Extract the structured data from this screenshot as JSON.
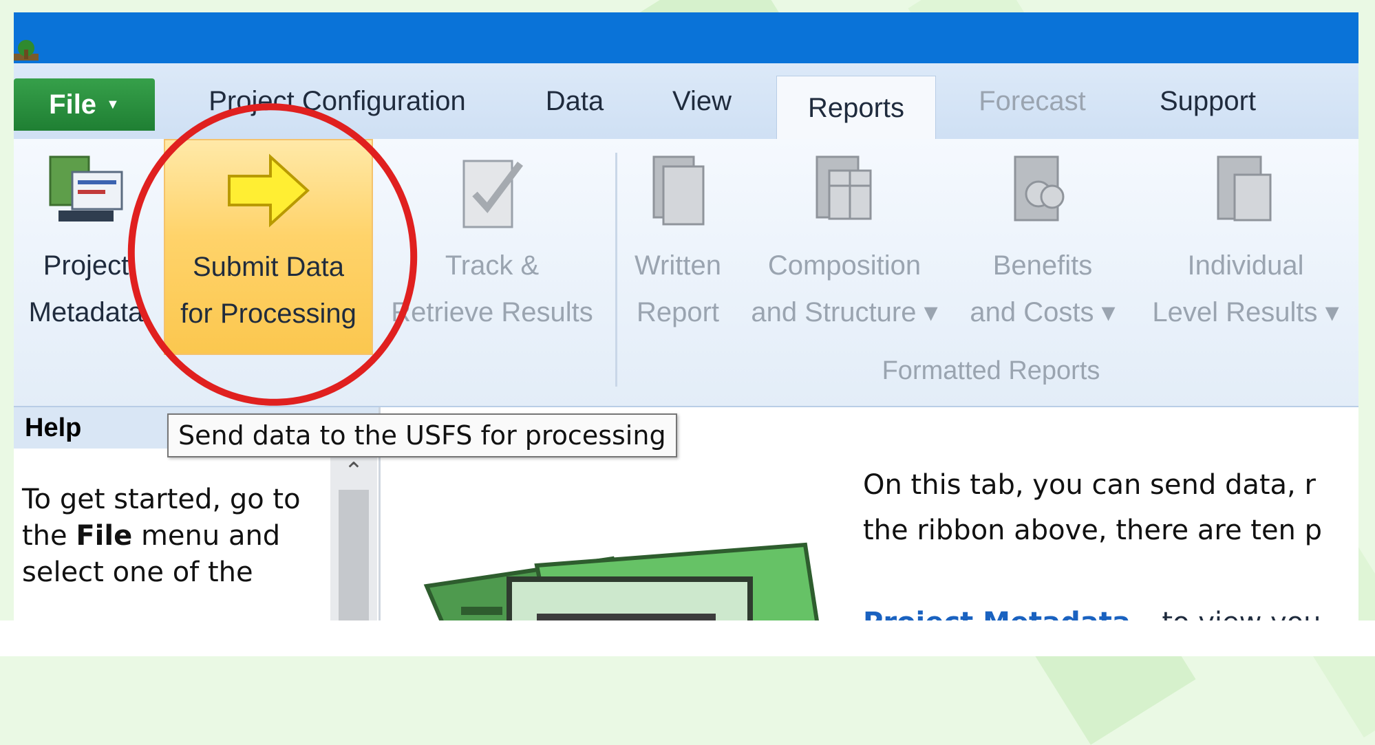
{
  "tabs": {
    "file": "File",
    "project_configuration": "Project Configuration",
    "data": "Data",
    "view": "View",
    "reports": "Reports",
    "forecast": "Forecast",
    "support": "Support"
  },
  "ribbon": {
    "project_metadata": [
      "Project",
      "Metadata"
    ],
    "submit_data": [
      "Submit Data",
      "for Processing"
    ],
    "track_retrieve": [
      "Track &",
      "Retrieve Results"
    ],
    "written_report": [
      "Written",
      "Report"
    ],
    "composition": [
      "Composition",
      "and Structure ▾"
    ],
    "benefits": [
      "Benefits",
      "and Costs ▾"
    ],
    "individual": [
      "Individual",
      "Level Results ▾"
    ],
    "group_label": "Formatted Reports"
  },
  "tooltip": "Send data to the USFS for processing",
  "help": {
    "title": "Help",
    "text_before": "To get started, go to the ",
    "text_bold": "File",
    "text_after": " menu and select one of the"
  },
  "main": {
    "intro_line1": "On this tab, you can send data, r",
    "intro_line2": "the ribbon above, there are ten p",
    "link_label": "Project Metadata",
    "link_rest": " – to view you"
  },
  "colors": {
    "titlebar": "#0a73d8",
    "file_tab": "#2a8f3e",
    "highlight": "#ffd36a",
    "annotation": "#e0201f"
  }
}
